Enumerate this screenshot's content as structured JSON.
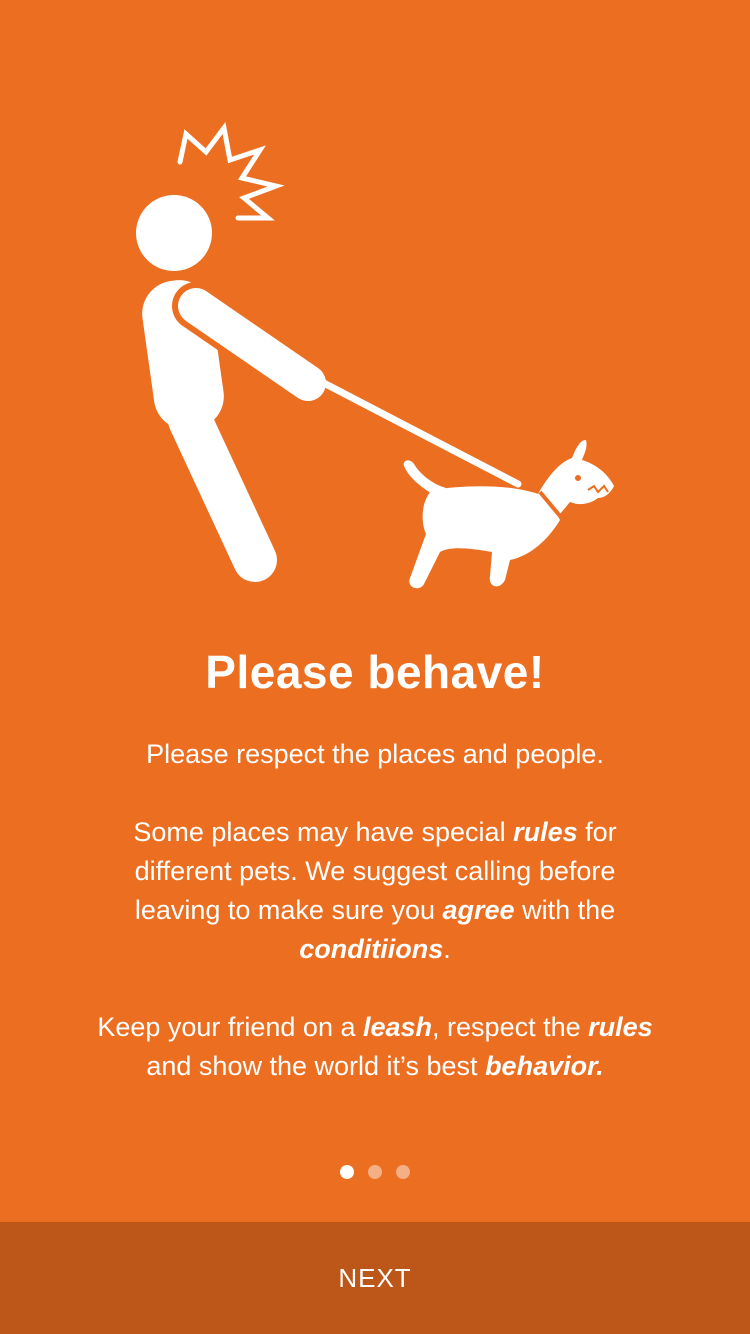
{
  "colors": {
    "background": "#EC6E21",
    "bottom_bar": "#BC5619",
    "foreground": "#FFFFFF"
  },
  "illustration": {
    "icon": "person-walking-dog-illustration"
  },
  "title": "Please behave!",
  "paragraphs": {
    "p1": "Please respect the places and people.",
    "p2_a": "Some places may have special ",
    "p2_rules": "rules",
    "p2_b": " for different pets. We suggest calling before leaving to make sure you ",
    "p2_agree": "agree",
    "p2_c": " with the ",
    "p2_conditions": "conditiions",
    "p2_d": ".",
    "p3_a": "Keep your friend on a ",
    "p3_leash": "leash",
    "p3_b": ", respect the ",
    "p3_rules": "rules",
    "p3_c": " and show the world it’s best ",
    "p3_behavior": "behavior."
  },
  "pagination": {
    "total": 3,
    "active": 1
  },
  "next_label": "NEXT"
}
